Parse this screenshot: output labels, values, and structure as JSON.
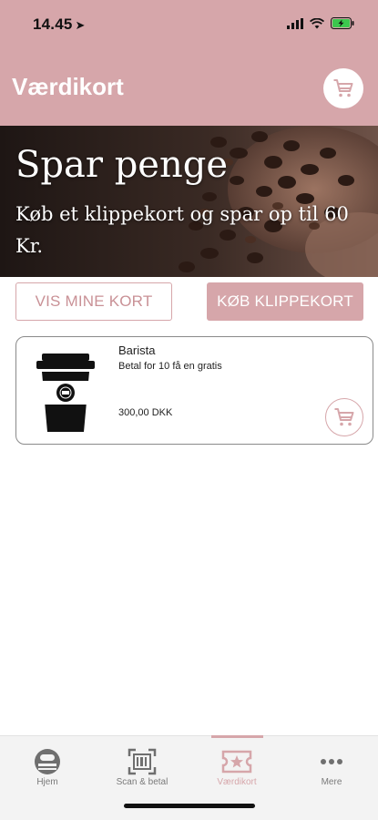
{
  "status_bar": {
    "time": "14.45"
  },
  "header": {
    "title": "Værdikort"
  },
  "banner": {
    "title": "Spar penge",
    "subtitle": "Køb et klippekort og spar op til 60 Kr."
  },
  "actions": {
    "my_cards_label": "VIS MINE KORT",
    "buy_label": "KØB KLIPPEKORT"
  },
  "products": [
    {
      "name": "Barista",
      "description": "Betal for 10 få en gratis",
      "price": "300,00 DKK"
    }
  ],
  "tabs": [
    {
      "label": "Hjem",
      "icon": "home-icon",
      "active": false
    },
    {
      "label": "Scan & betal",
      "icon": "scan-icon",
      "active": false
    },
    {
      "label": "Værdikort",
      "icon": "ticket-star-icon",
      "active": true
    },
    {
      "label": "Mere",
      "icon": "more-icon",
      "active": false
    }
  ],
  "colors": {
    "accent": "#d6a6aa",
    "tab_inactive": "#7a7a7a"
  }
}
